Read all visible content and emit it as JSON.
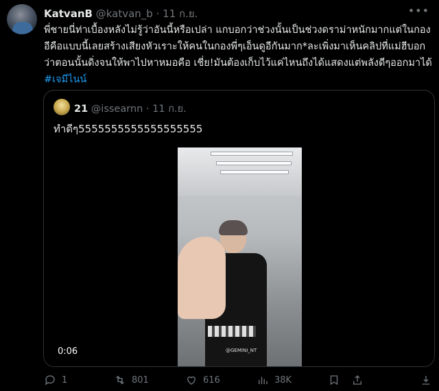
{
  "tweet": {
    "author": {
      "name": "KatvanB",
      "handle": "@katvan_b",
      "separator": "·",
      "date": "11 ก.ย."
    },
    "more_icon": "more-icon",
    "text": "พี่ชายนี่ท่าเบื้องหลังไม่รู้ว่าอันนี้หรือเปล่า แกบอกว่าช่วงนั้นเป็นช่วงดราม่าหนักมากแต่ในกองอีคือแบบนี้เลยสร้างเสียงหัวเราะให้คนในกองพี่ๆเอ็นดูอีกันมาก*ละเพิ่งมาเห็นคลิปที่แม่ฮีบอกว่าตอนนั้นดิ่งจนให้พาไปหาหมอคือ เชี่ย!มันต้องเก็บไว้แค่ไหนถึงได้แสดงแต่พลังดีๆออกมาได้",
    "hashtag": "#เจมีไนน์"
  },
  "quote": {
    "author": {
      "name": "21",
      "handle": "@issearnn",
      "separator": "·",
      "date": "11 ก.ย."
    },
    "text": "ทำดีๆ5555555555555555555",
    "video": {
      "timestamp": "0:06",
      "watermark": "@GEMINI_NT"
    }
  },
  "actions": {
    "reply": {
      "icon": "reply-icon",
      "count": "1"
    },
    "retweet": {
      "icon": "retweet-icon",
      "count": "801"
    },
    "like": {
      "icon": "like-icon",
      "count": "616"
    },
    "views": {
      "icon": "views-icon",
      "count": "38K"
    },
    "bookmark": {
      "icon": "bookmark-icon"
    },
    "share": {
      "icon": "share-icon"
    },
    "download": {
      "icon": "download-icon"
    }
  }
}
